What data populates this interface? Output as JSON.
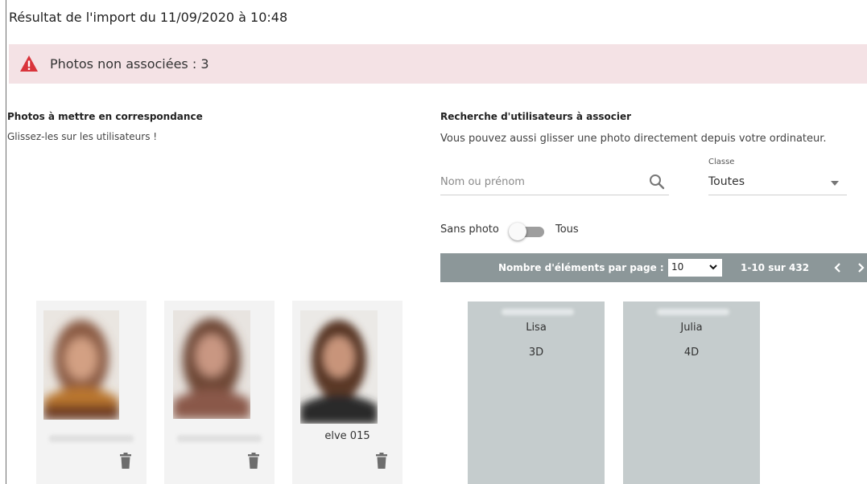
{
  "page": {
    "title": "Résultat de l'import du 11/09/2020 à 10:48"
  },
  "alert": {
    "icon": "warning-icon",
    "text": "Photos non associées : 3",
    "background": "#f4e2e5",
    "icon_color": "#d9343b"
  },
  "left_panel": {
    "heading": "Photos à mettre en correspondance",
    "subtitle": "Glissez-les sur les utilisateurs !",
    "photos": [
      {
        "name": "",
        "name_blurred": true,
        "delete_icon": "trash-icon"
      },
      {
        "name": "",
        "name_blurred": true,
        "delete_icon": "trash-icon"
      },
      {
        "name": "elve 015",
        "name_blurred": false,
        "delete_icon": "trash-icon"
      }
    ]
  },
  "right_panel": {
    "heading": "Recherche d'utilisateurs à associer",
    "subtitle": "Vous pouvez aussi glisser une photo directement depuis votre ordinateur.",
    "search": {
      "placeholder": "Nom ou prénom",
      "value": "",
      "icon": "search-icon"
    },
    "class_filter": {
      "label": "Classe",
      "value": "Toutes"
    },
    "photo_toggle": {
      "left_label": "Sans photo",
      "right_label": "Tous"
    },
    "pagination": {
      "label": "Nombre d'éléments par page :",
      "per_page": "10",
      "range": "1-10 sur 432",
      "bar_color": "#8c9799"
    },
    "users": [
      {
        "first_name": "Lisa",
        "class": "3D"
      },
      {
        "first_name": "Julia",
        "class": "4D"
      }
    ],
    "user_card_color": "#c5cccd"
  }
}
